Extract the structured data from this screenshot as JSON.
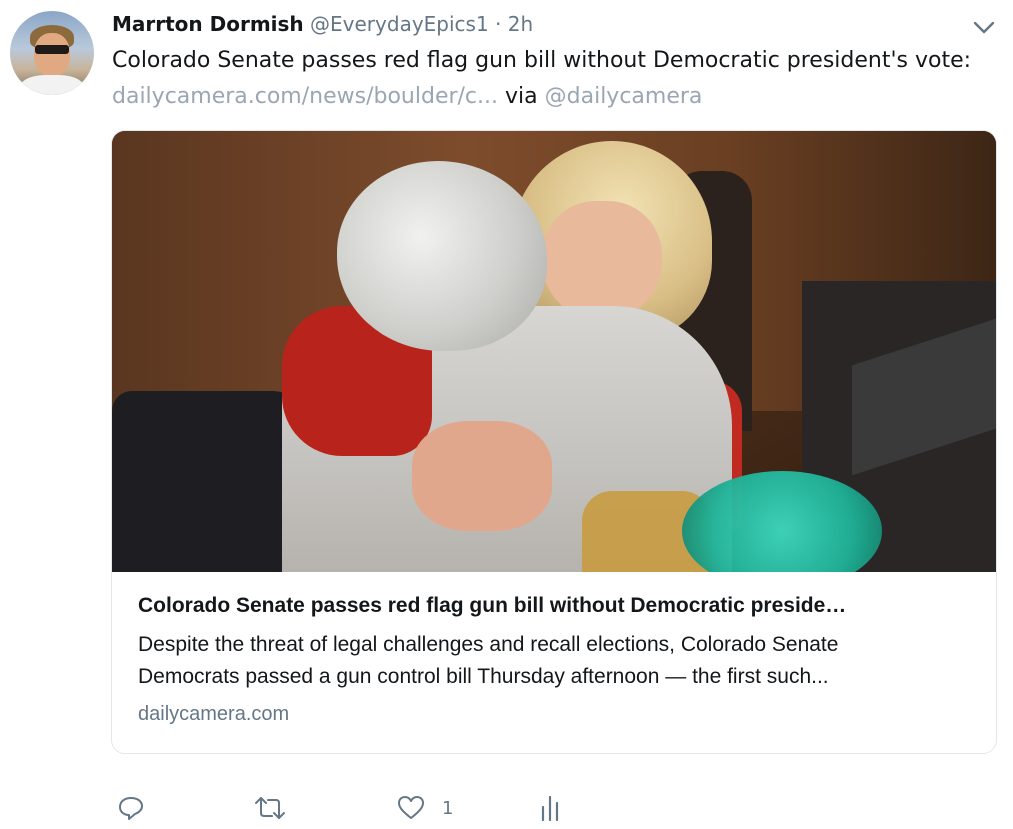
{
  "tweet": {
    "author_name": "Marrton Dormish",
    "author_handle": "@EverydayEpics1",
    "separator": "·",
    "time": "2h",
    "text": "Colorado Senate passes red flag gun bill without Democratic president's vote:",
    "link_text": "dailycamera.com/news/boulder/c...",
    "via_text": "via",
    "via_handle": "@dailycamera"
  },
  "card": {
    "title": "Colorado Senate passes red flag gun bill without Democratic preside…",
    "description_line1": "Despite the threat of legal challenges and recall elections, Colorado Senate",
    "description_line2": "Democrats passed a gun control bill Thursday afternoon — the first such...",
    "domain": "dailycamera.com"
  },
  "actions": {
    "reply_icon": "reply-icon",
    "retweet_icon": "retweet-icon",
    "like_icon": "heart-icon",
    "like_count": "1",
    "analytics_icon": "analytics-icon"
  },
  "colors": {
    "text": "#14171a",
    "secondary": "#657786",
    "link": "#9aa6b2",
    "border": "#e1e8ed"
  }
}
